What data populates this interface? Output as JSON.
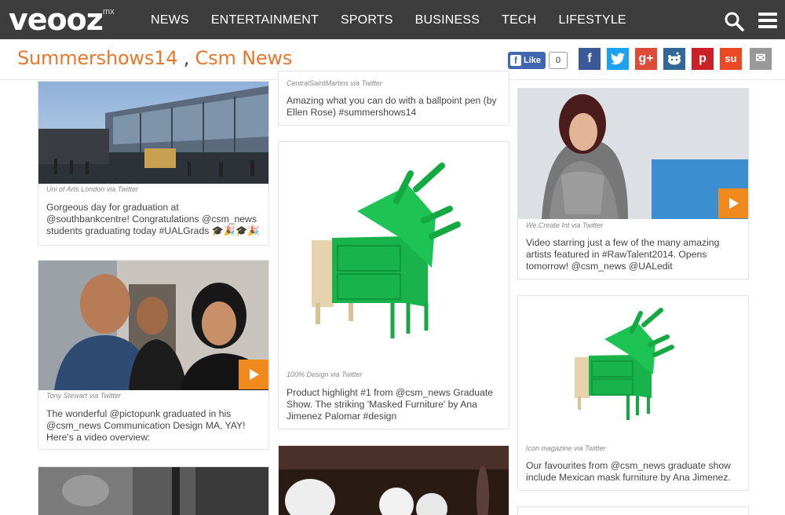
{
  "brand": {
    "logo": "veooz",
    "region": "mx"
  },
  "nav": [
    "NEWS",
    "ENTERTAINMENT",
    "SPORTS",
    "BUSINESS",
    "TECH",
    "LIFESTYLE"
  ],
  "header": {
    "title_primary": "Summershows14",
    "title_separator": " , ",
    "title_secondary": "Csm News"
  },
  "social": {
    "like_label": "Like",
    "like_count": "0",
    "buttons": [
      {
        "name": "facebook",
        "glyph": "f",
        "color": "#3b5998"
      },
      {
        "name": "twitter",
        "glyph": "t",
        "color": "#1da1f2"
      },
      {
        "name": "google-plus",
        "glyph": "g+",
        "color": "#dd4b39"
      },
      {
        "name": "reddit",
        "glyph": "r",
        "color": "#336699"
      },
      {
        "name": "pinterest",
        "glyph": "p",
        "color": "#cb2027"
      },
      {
        "name": "stumbleupon",
        "glyph": "su",
        "color": "#eb4924"
      },
      {
        "name": "email",
        "glyph": "✉",
        "color": "#999999"
      }
    ]
  },
  "cards": [
    {
      "via": "Uni of Arts London via Twitter",
      "caption": "Gorgeous day for graduation at @southbankcentre! Congratulations @csm_news students graduating today #UALGrads 🎓🎉🎓🎉",
      "video": false
    },
    {
      "via": "CentralSaintMartins via Twitter",
      "caption": "Amazing what you can do with a ballpoint pen (by Ellen Rose) #summershows14",
      "video": false
    },
    {
      "via": "We.Create Int via Twitter",
      "caption": "Video starring just a few of the many amazing artists featured in #RawTalent2014. Opens tomorrow! @csm_news @UALedit",
      "video": true
    },
    {
      "via": "Tony Stewart via Twitter",
      "caption": "The wonderful @pictopunk graduated in his @csm_news Communication Design MA, YAY! Here's a video overview:",
      "video": true
    },
    {
      "via": "100% Design via Twitter",
      "caption": "Product highlight #1 from @csm_news Graduate Show. The striking 'Masked Furniture' by Ana Jimenez Palomar #design",
      "video": false
    },
    {
      "via": "Icon magazine via Twitter",
      "caption": "Our favourites from @csm_news graduate show include Mexican mask furniture by Ana Jimenez.",
      "video": false
    }
  ]
}
